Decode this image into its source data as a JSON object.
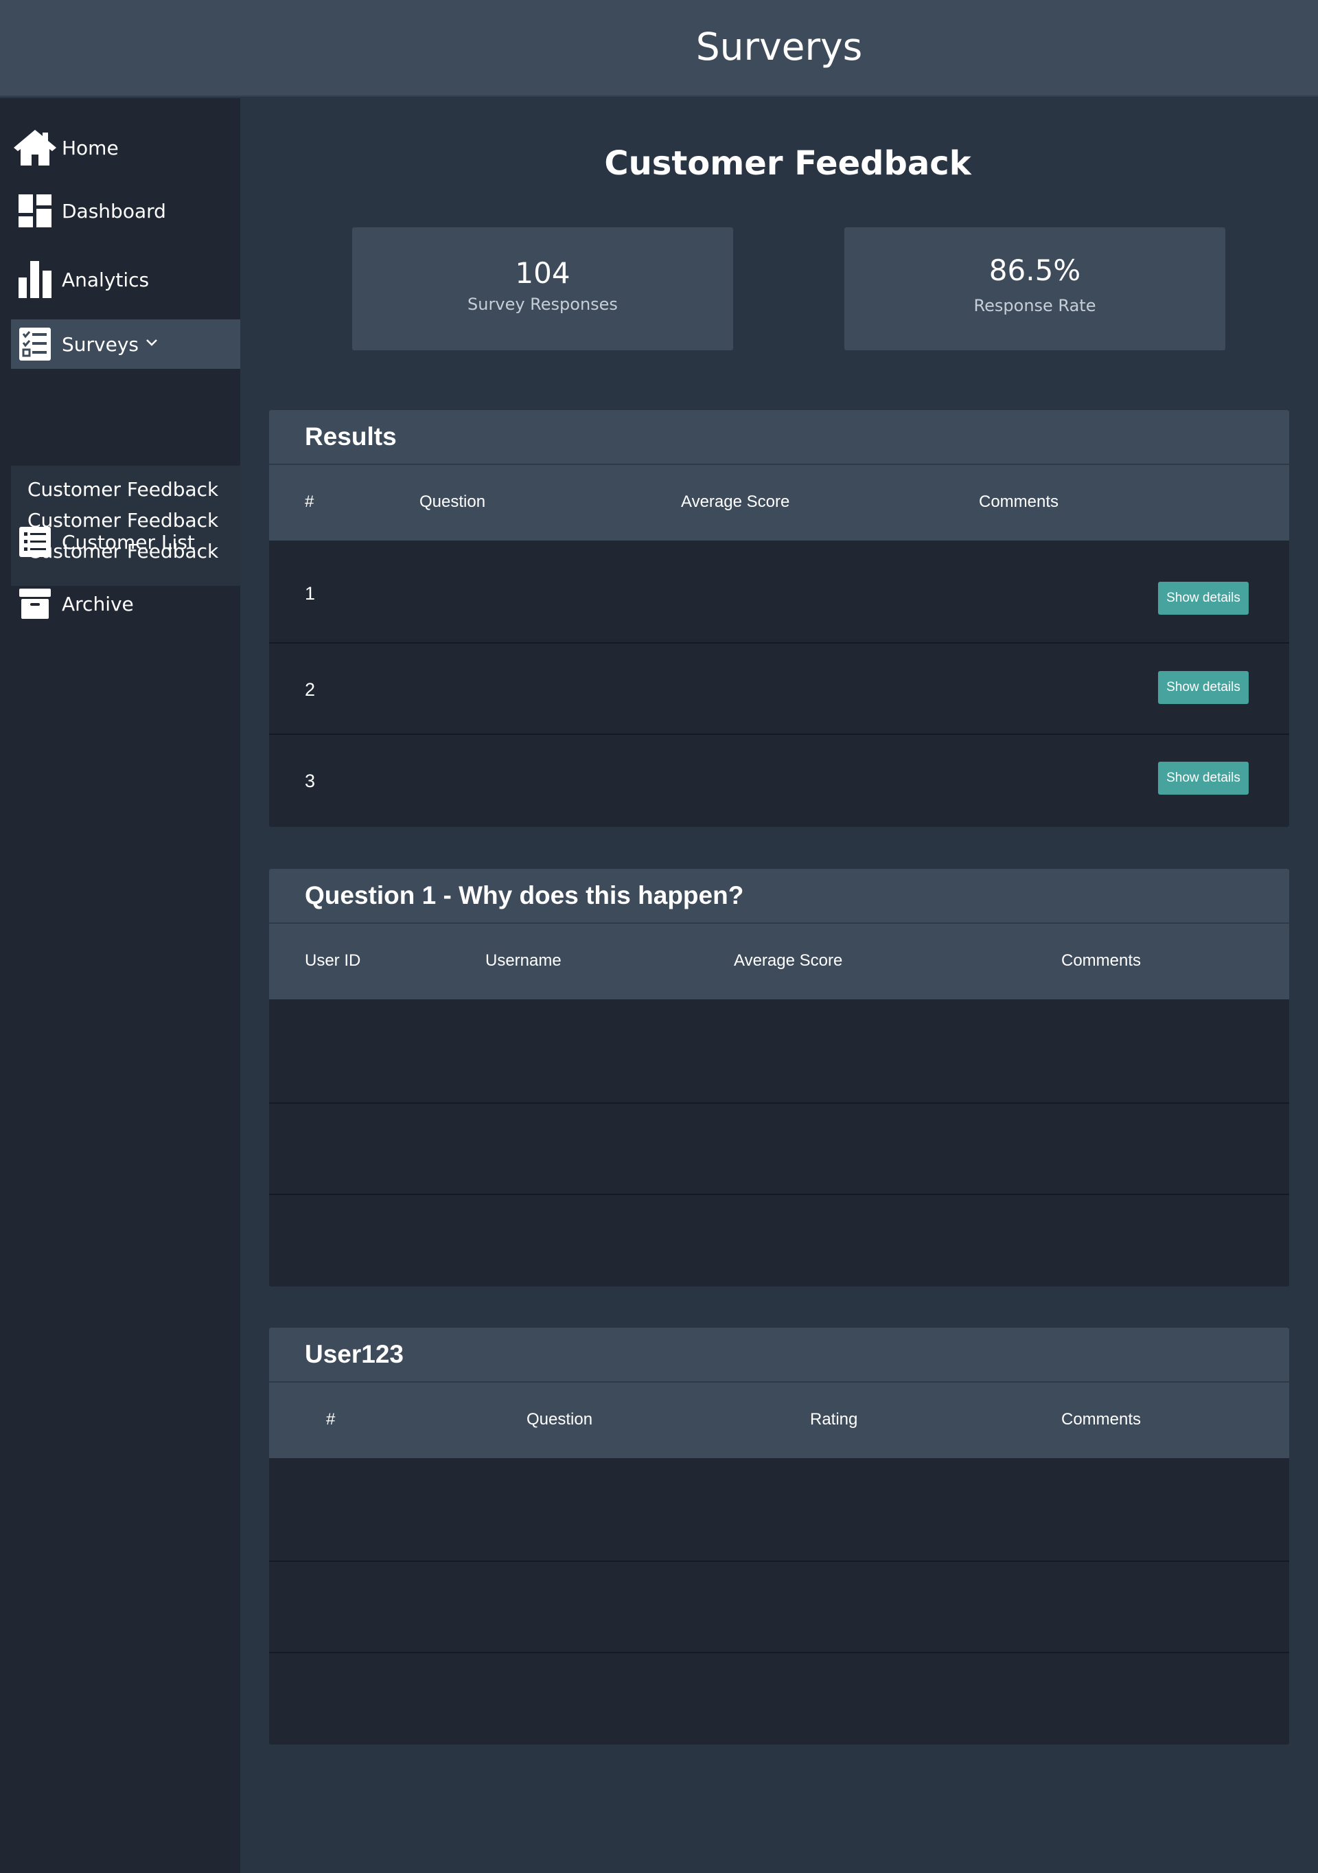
{
  "app": {
    "title": "Surverys"
  },
  "sidebar": {
    "items": [
      {
        "label": "Home",
        "icon": "home-icon"
      },
      {
        "label": "Dashboard",
        "icon": "dashboard-icon"
      },
      {
        "label": "Analytics",
        "icon": "bar-chart-icon"
      },
      {
        "label": "Surveys",
        "icon": "checklist-icon",
        "active": true
      },
      {
        "label": "Customer List",
        "icon": "list-icon"
      },
      {
        "label": "Archive",
        "icon": "archive-icon"
      }
    ],
    "surveys_sub": [
      "Customer Feedback",
      "Customer Feedback",
      "Customer Feedback"
    ]
  },
  "main": {
    "heading": "Customer Feedback",
    "stats": [
      {
        "value": "104",
        "label": "Survey Responses"
      },
      {
        "value": "86.5%",
        "label": "Response Rate"
      }
    ],
    "results": {
      "title": "Results",
      "columns": [
        "#",
        "Question",
        "Average Score",
        "Comments"
      ],
      "rows": [
        {
          "num": "1",
          "button": "Show details"
        },
        {
          "num": "2",
          "button": "Show details"
        },
        {
          "num": "3",
          "button": "Show details"
        }
      ]
    },
    "question": {
      "title": "Question 1 - Why does this happen?",
      "columns": [
        "User ID",
        "Username",
        "Average Score",
        "Comments"
      ]
    },
    "user": {
      "title": "User123",
      "columns": [
        "#",
        "Question",
        "Rating",
        "Comments"
      ]
    }
  },
  "colors": {
    "accent": "#46a39d",
    "topbar": "#3d4b5b",
    "sidebar": "#202733",
    "background": "#2a3543"
  }
}
